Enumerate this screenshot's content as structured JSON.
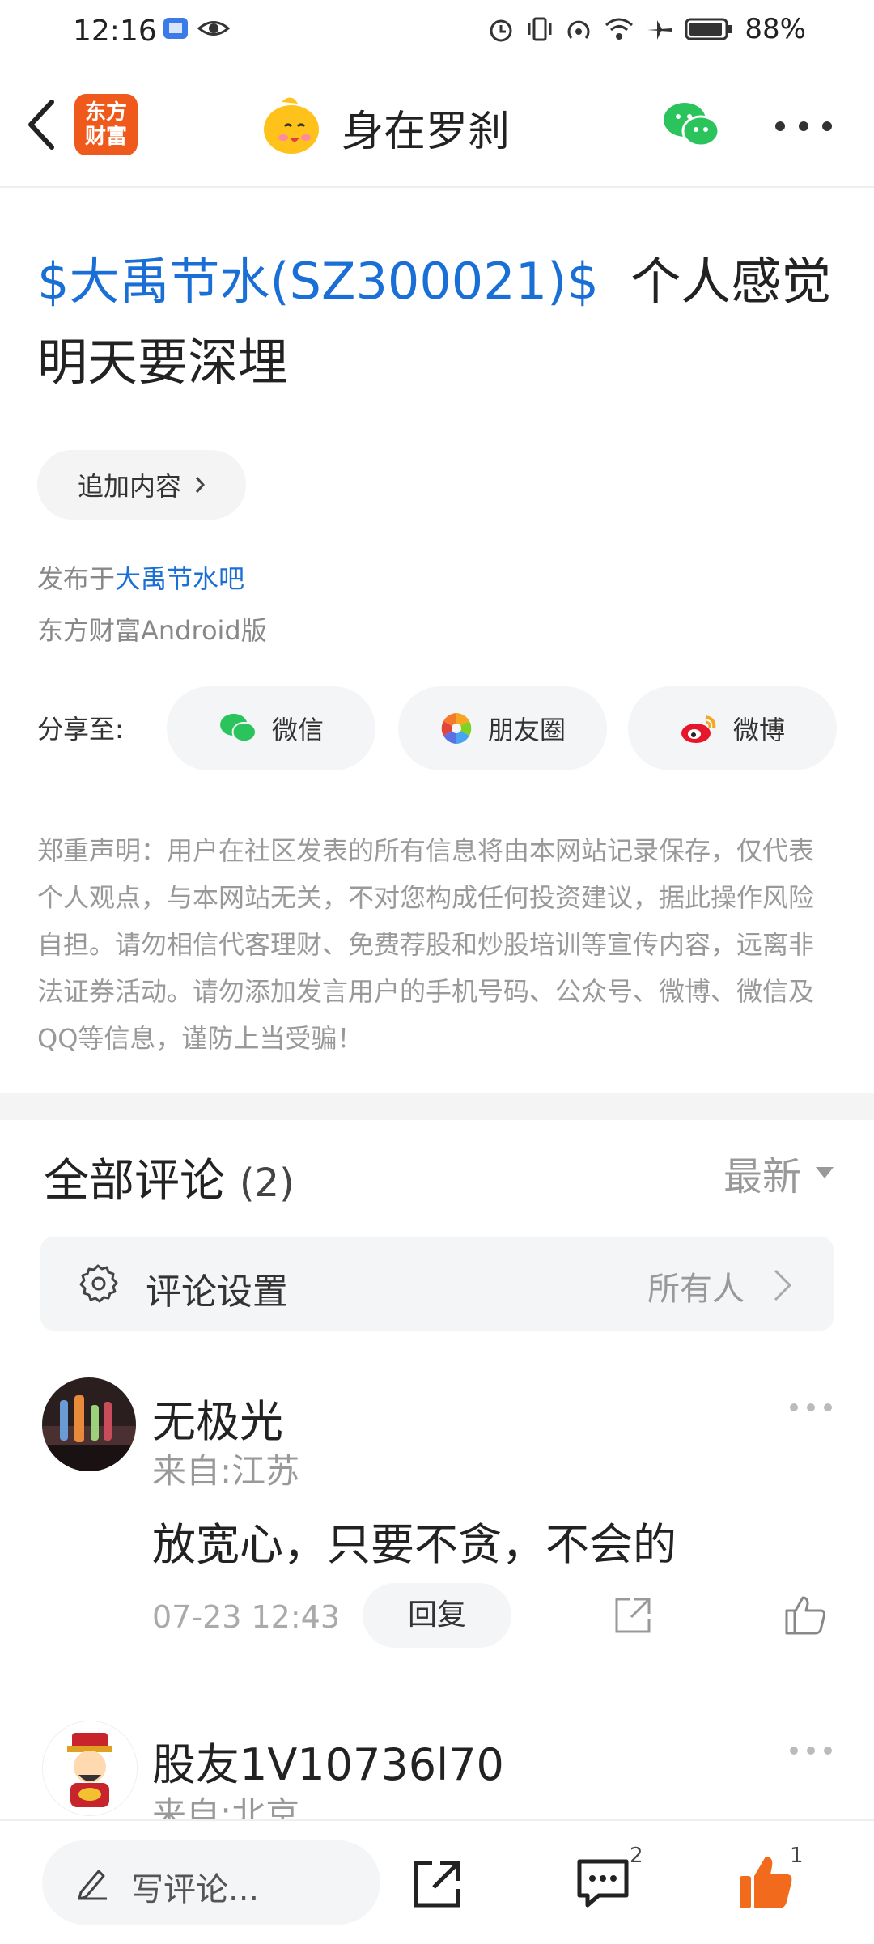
{
  "status_bar": {
    "time": "12:16",
    "battery": "88%"
  },
  "header": {
    "app_logo": "东方\n财富",
    "author_name": "身在罗刹"
  },
  "post": {
    "stock_tag": "$大禹节水(SZ300021)$",
    "title_text": "个人感觉明天要深埋",
    "add_content_label": "追加内容",
    "published_prefix": "发布于",
    "published_bar": "大禹节水吧",
    "client": "东方财富Android版"
  },
  "share": {
    "label": "分享至:",
    "options": [
      "微信",
      "朋友圈",
      "微博"
    ]
  },
  "disclaimer": "郑重声明：用户在社区发表的所有信息将由本网站记录保存，仅代表个人观点，与本网站无关，不对您构成任何投资建议，据此操作风险自担。请勿相信代客理财、免费荐股和炒股培训等宣传内容，远离非法证券活动。请勿添加发言用户的手机号码、公众号、微博、微信及QQ等信息，谨防上当受骗！",
  "comments": {
    "title": "全部评论",
    "count": "(2)",
    "sort_label": "最新",
    "settings_label": "评论设置",
    "settings_value": "所有人",
    "items": [
      {
        "name": "无极光",
        "location": "来自:江苏",
        "text": "放宽心，只要不贪，不会的",
        "time": "07-23 12:43",
        "reply_label": "回复"
      },
      {
        "name": "股友1V10736l70",
        "location": "来自:北京"
      }
    ]
  },
  "bottom_bar": {
    "write_placeholder": "写评论...",
    "comment_count": "2",
    "like_count": "1"
  },
  "colors": {
    "accent_blue": "#1a6fd6",
    "like_orange": "#f26a1b",
    "logo_orange": "#ef5a1c"
  }
}
